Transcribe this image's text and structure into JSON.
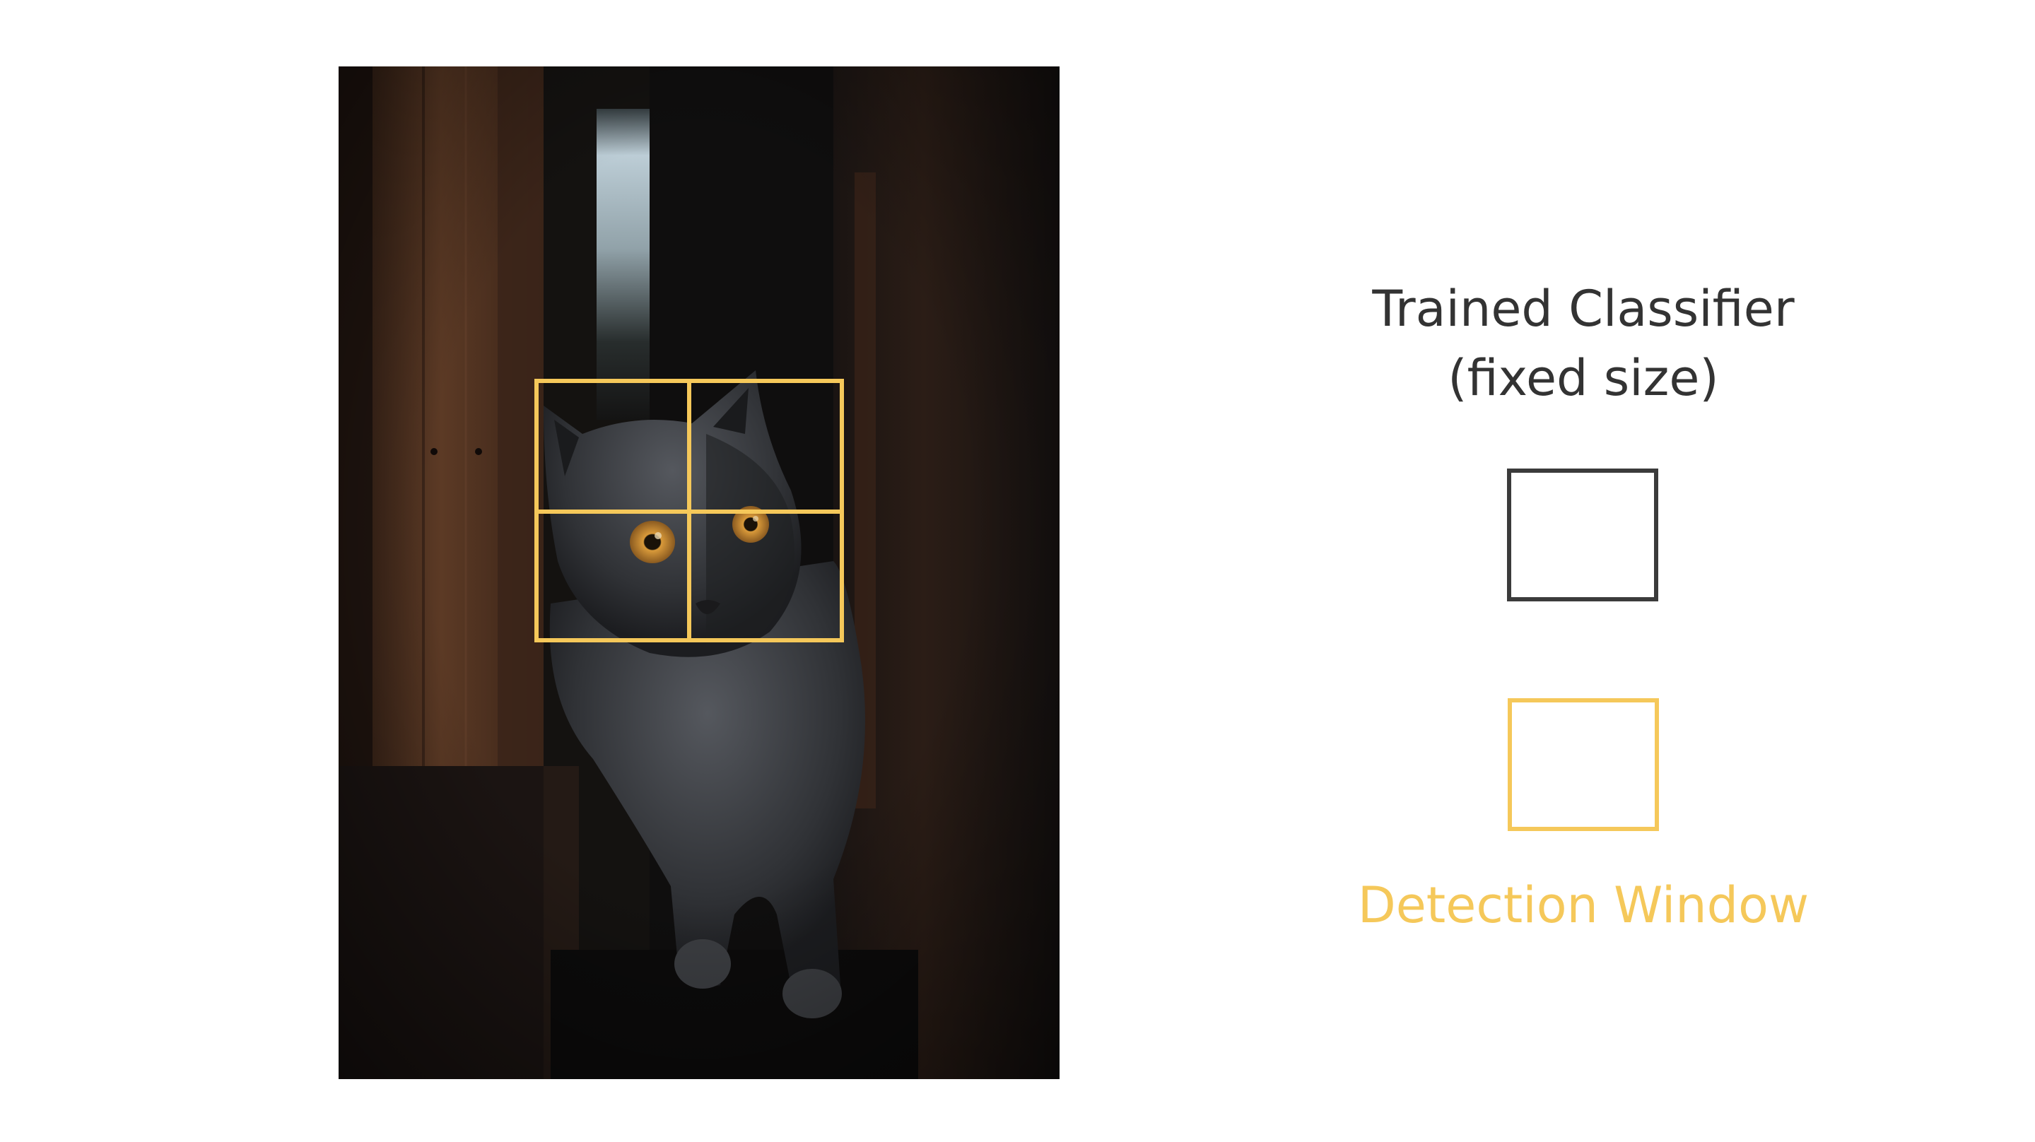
{
  "classifier": {
    "title_line1": "Trained Classifier",
    "title_line2": "(fixed size)",
    "box_color": "#3b3b3b"
  },
  "detection": {
    "label": "Detection Window",
    "color": "#f5c85a",
    "grid": {
      "rows": 2,
      "cols": 2
    }
  },
  "photo": {
    "subject": "gray cat with amber eyes in dark wooden doorway"
  }
}
